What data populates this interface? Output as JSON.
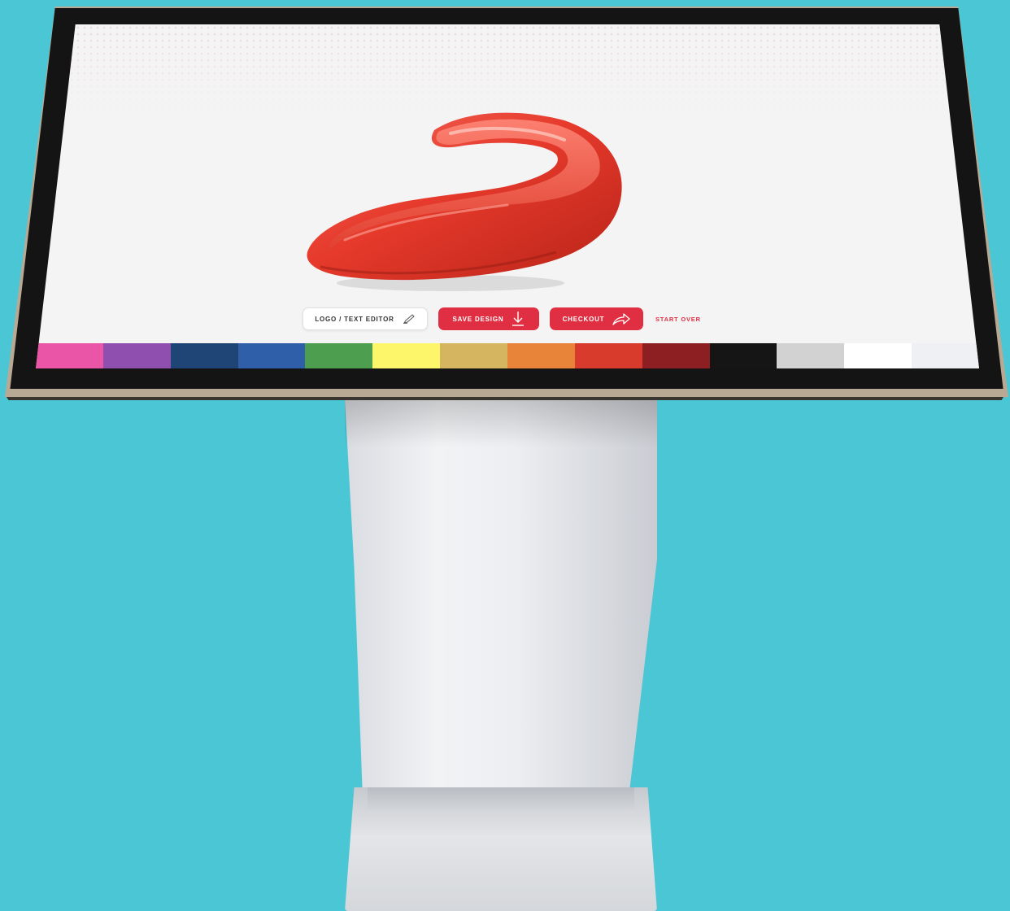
{
  "toolbar": {
    "editor_label": "LOGO / TEXT EDITOR",
    "save_label": "SAVE DESIGN",
    "checkout_label": "CHECKOUT",
    "start_over_label": "START OVER"
  },
  "icons": {
    "editor": "pencil-icon",
    "save": "download-icon",
    "checkout": "share-arrow-icon"
  },
  "colors": {
    "accent": "#e02f42",
    "background": "#4ac6d4",
    "product": "#ea3c30"
  },
  "palette": [
    {
      "name": "pink",
      "color": "#ea55a8"
    },
    {
      "name": "purple",
      "color": "#8e4fae"
    },
    {
      "name": "navy",
      "color": "#1f4577"
    },
    {
      "name": "blue",
      "color": "#2f5fa9"
    },
    {
      "name": "green",
      "color": "#4d9f4f"
    },
    {
      "name": "yellow",
      "color": "#fdf56a"
    },
    {
      "name": "gold",
      "color": "#d6b560"
    },
    {
      "name": "orange",
      "color": "#e8843a"
    },
    {
      "name": "red",
      "color": "#d83a2b"
    },
    {
      "name": "maroon",
      "color": "#8d1f22"
    },
    {
      "name": "black",
      "color": "#151515"
    },
    {
      "name": "silver",
      "color": "#d2d2d2"
    },
    {
      "name": "white",
      "color": "#ffffff"
    },
    {
      "name": "clear",
      "color": "#eef0f3"
    }
  ]
}
